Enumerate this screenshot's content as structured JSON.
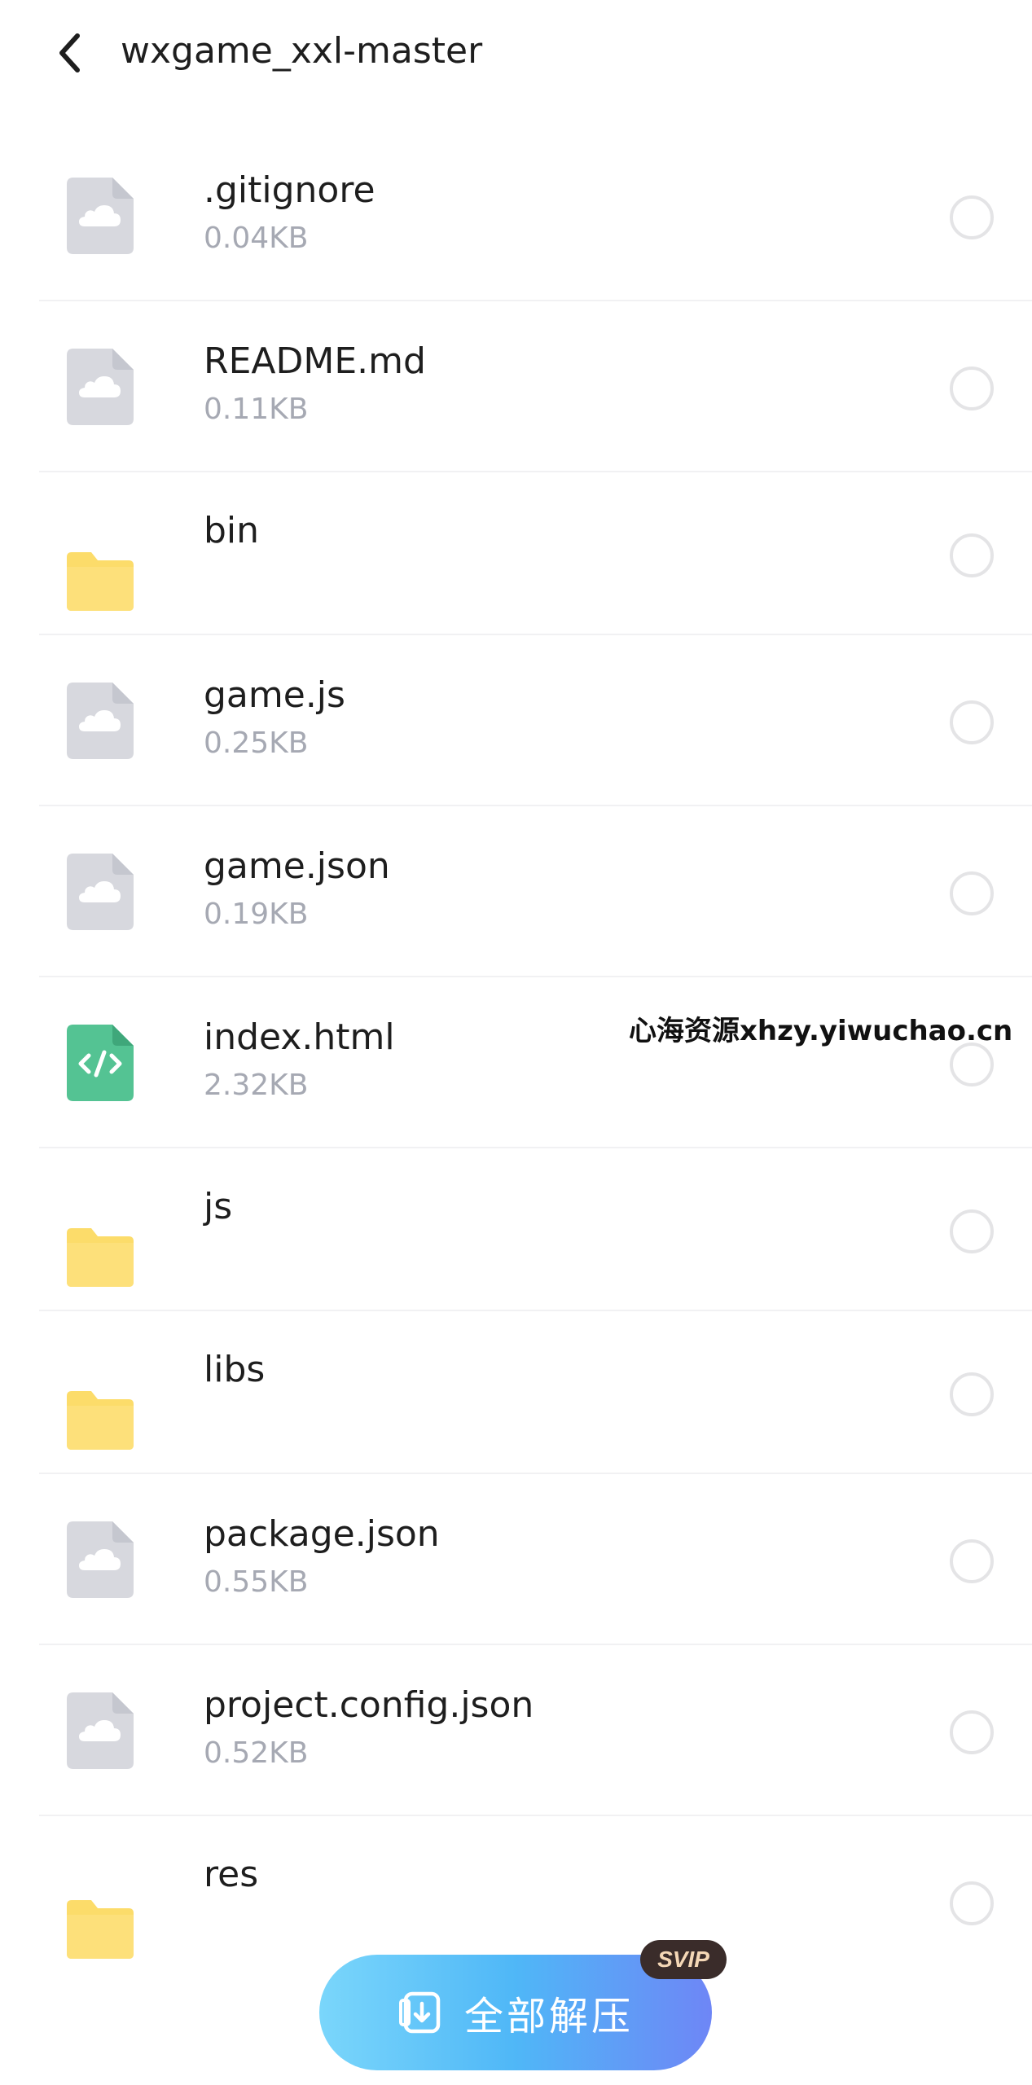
{
  "header": {
    "title": "wxgame_xxl-master",
    "back_icon": "chevron-left-icon"
  },
  "files": [
    {
      "name": ".gitignore",
      "size": "0.04KB",
      "type": "file",
      "icon": "cloud-file-icon"
    },
    {
      "name": "README.md",
      "size": "0.11KB",
      "type": "file",
      "icon": "cloud-file-icon"
    },
    {
      "name": "bin",
      "size": "",
      "type": "folder",
      "icon": "folder-icon"
    },
    {
      "name": "game.js",
      "size": "0.25KB",
      "type": "file",
      "icon": "cloud-file-icon"
    },
    {
      "name": "game.json",
      "size": "0.19KB",
      "type": "file",
      "icon": "cloud-file-icon"
    },
    {
      "name": "index.html",
      "size": "2.32KB",
      "type": "code",
      "icon": "code-file-icon"
    },
    {
      "name": "js",
      "size": "",
      "type": "folder",
      "icon": "folder-icon"
    },
    {
      "name": "libs",
      "size": "",
      "type": "folder",
      "icon": "folder-icon"
    },
    {
      "name": "package.json",
      "size": "0.55KB",
      "type": "file",
      "icon": "cloud-file-icon"
    },
    {
      "name": "project.config.json",
      "size": "0.52KB",
      "type": "file",
      "icon": "cloud-file-icon"
    },
    {
      "name": "res",
      "size": "",
      "type": "folder",
      "icon": "folder-icon"
    }
  ],
  "watermark": "心海资源xhzy.yiwuchao.cn",
  "extract_button": {
    "label": "全部解压",
    "badge": "SVIP"
  },
  "colors": {
    "folder": "#fcdc6a",
    "file_icon": "#d7d8de",
    "code_icon": "#54c393",
    "size_text": "#a6a9b3",
    "button_start": "#7ad6fb",
    "button_end": "#6e86f6"
  }
}
